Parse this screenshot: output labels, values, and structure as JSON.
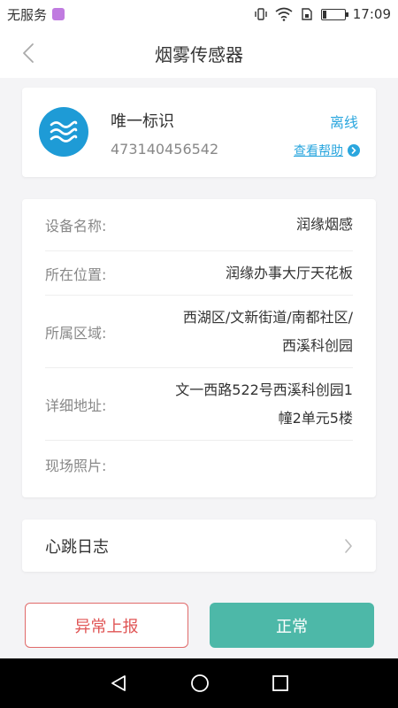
{
  "status_bar": {
    "carrier": "无服务",
    "time": "17:09"
  },
  "header": {
    "title": "烟雾传感器"
  },
  "device": {
    "label": "唯一标识",
    "id": "473140456542",
    "status": "离线",
    "help": "查看帮助"
  },
  "details": [
    {
      "label": "设备名称:",
      "value": "润缘烟感"
    },
    {
      "label": "所在位置:",
      "value": "润缘办事大厅天花板"
    },
    {
      "label": "所属区域:",
      "value_lines": [
        "西湖区/文新街道/南都社区/",
        "西溪科创园"
      ]
    },
    {
      "label": "详细地址:",
      "value_lines": [
        "文一西路522号西溪科创园1",
        "幢2单元5楼"
      ]
    },
    {
      "label": "现场照片:",
      "value": ""
    }
  ],
  "heartbeat": {
    "label": "心跳日志"
  },
  "actions": {
    "report": "异常上报",
    "normal": "正常"
  },
  "colors": {
    "accent_blue": "#2aa6de",
    "avatar_blue": "#1e9bd6",
    "report_red": "#e05555",
    "normal_teal": "#4db8a8"
  }
}
